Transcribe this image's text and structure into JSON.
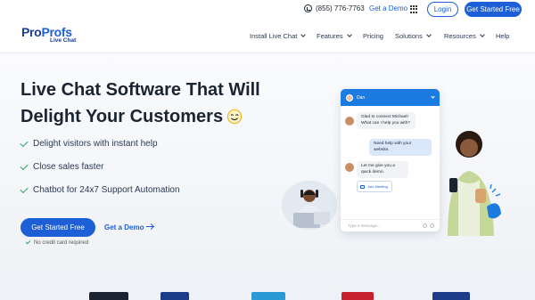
{
  "topbar": {
    "phone": "(855) 776-7763",
    "demo_link": "Get a Demo",
    "login": "Login",
    "get_started": "Get Started Free"
  },
  "logo": {
    "brand_part1": "Pro",
    "brand_part2": "Profs",
    "product": "Live Chat"
  },
  "nav": [
    {
      "label": "Install Live Chat",
      "has_dropdown": true
    },
    {
      "label": "Features",
      "has_dropdown": true
    },
    {
      "label": "Pricing",
      "has_dropdown": false
    },
    {
      "label": "Solutions",
      "has_dropdown": true
    },
    {
      "label": "Resources",
      "has_dropdown": true
    },
    {
      "label": "Help",
      "has_dropdown": false
    }
  ],
  "hero": {
    "headline_line1": "Live Chat Software That Will",
    "headline_line2": "Delight Your Customers",
    "bullets": [
      "Delight visitors with instant help",
      "Close sales faster",
      "Chatbot for 24x7 Support Automation"
    ],
    "cta": "Get Started Free",
    "demo": "Get a Demo",
    "no_card": "No credit card required"
  },
  "chat_widget": {
    "agent_name": "Dan",
    "messages": [
      {
        "from": "agent",
        "text": "Glad to connect Michael! What can I help you with?"
      },
      {
        "from": "user",
        "text": "Need help with your website."
      },
      {
        "from": "agent",
        "text": "Let me give you a quick demo."
      }
    ],
    "join_meeting": "Join Meeting",
    "input_placeholder": "Type a Message..."
  },
  "colors": {
    "primary": "#1c5fd6",
    "brand_dark": "#1c3c8a",
    "check_green": "#2fa86b",
    "chat_header": "#1c7be0"
  }
}
